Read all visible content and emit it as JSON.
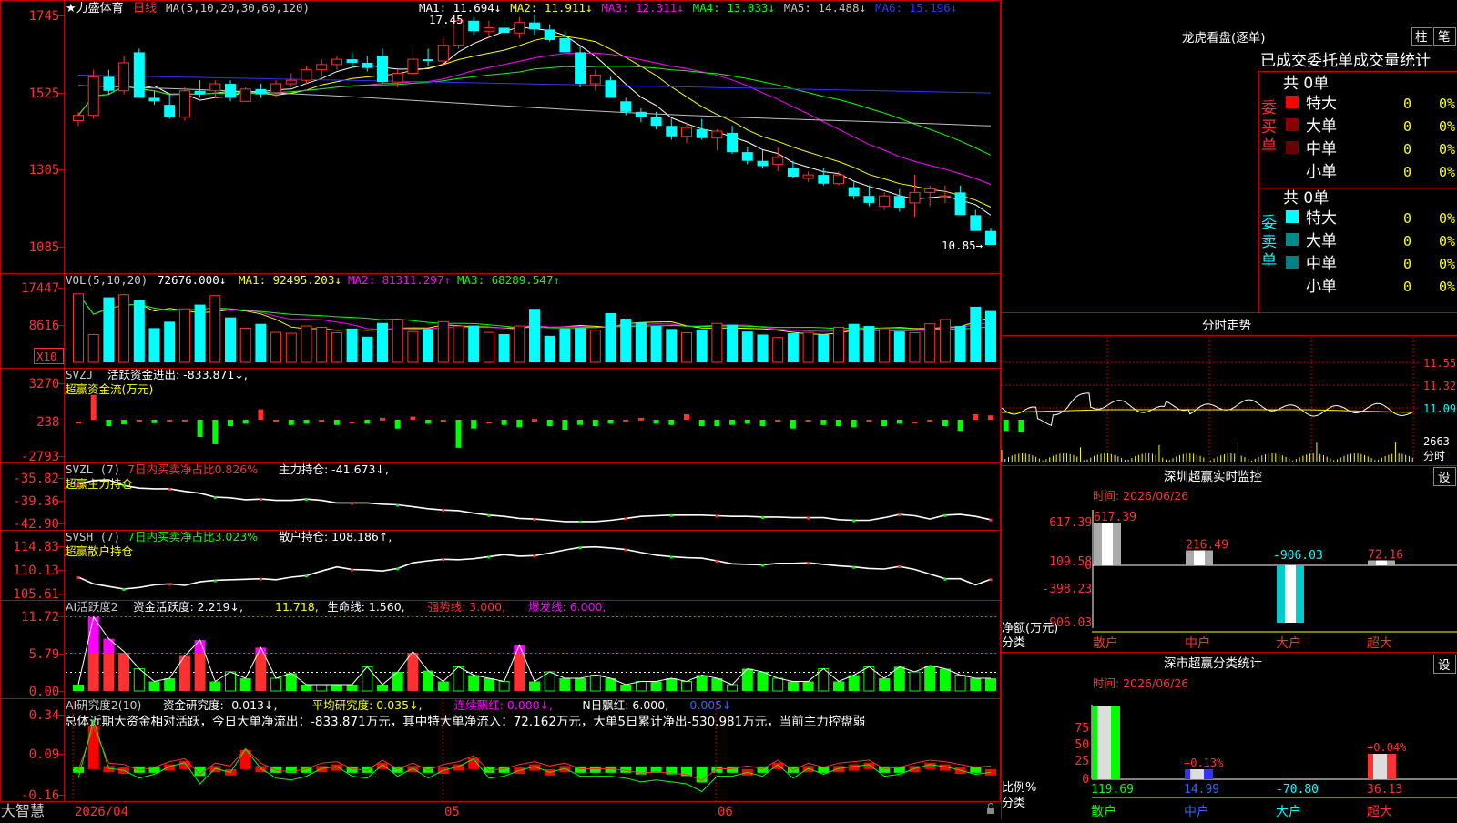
{
  "app": {
    "brand": "大智慧"
  },
  "kline": {
    "title": "★力盛体育",
    "period": "日线",
    "ma_header": "MA(5,10,20,30,60,120)",
    "ma_items": [
      {
        "text": "MA1: 11.694↓",
        "color": "#ffffff"
      },
      {
        "text": "MA2: 11.911↓",
        "color": "#ffff00"
      },
      {
        "text": "MA3: 12.311↓",
        "color": "#ff00ff"
      },
      {
        "text": "MA4: 13.033↓",
        "color": "#00ff00"
      },
      {
        "text": "MA5: 14.488↓",
        "color": "#c0c0c0"
      },
      {
        "text": "MA6: 15.196↓",
        "color": "#3333ff"
      }
    ],
    "y_ticks": [
      "1745",
      "1525",
      "1305",
      "1085"
    ],
    "high_label": "17.45",
    "low_label": "10.85→"
  },
  "vol": {
    "header": "VOL(5,10,20)",
    "value": "72676.000↓",
    "items": [
      {
        "text": "MA1: 92495.203↓",
        "color": "#ffff00"
      },
      {
        "text": "MA2: 81311.297↑",
        "color": "#ff00ff"
      },
      {
        "text": "MA3: 68289.547↑",
        "color": "#00ff00"
      }
    ],
    "y_ticks": [
      "17447",
      "8616"
    ],
    "unit": "X10"
  },
  "svzj": {
    "header": "SVZJ",
    "item": "活跃资金进出: -833.871↓,",
    "sub": "超赢资金流(万元)",
    "y_ticks": [
      "3270",
      "238",
      "-2793"
    ]
  },
  "svzl": {
    "header": "SVZL (7)",
    "item1": "7日内买卖净占比0.826%",
    "item2": "主力持仓: -41.673↓,",
    "sub": "超赢主力持仓",
    "y_ticks": [
      "-35.82",
      "-39.36",
      "-42.90"
    ]
  },
  "svsh": {
    "header": "SVSH (7)",
    "item1": "7日内买卖净占比3.023%",
    "item2": "散户持仓: 108.186↑,",
    "sub": "超赢散户持仓",
    "y_ticks": [
      "114.83",
      "110.13",
      "105.61"
    ]
  },
  "ai1": {
    "header": "AI活跃度2",
    "items": [
      {
        "text": "资金活跃度: 2.219↓,",
        "color": "#ffffff"
      },
      {
        "text": "11.718,",
        "color": "#ffff00"
      },
      {
        "text": "生命线: 1.560,",
        "color": "#ffffff"
      },
      {
        "text": "强势线: 3.000,",
        "color": "#ff3030"
      },
      {
        "text": "爆发线: 6.000,",
        "color": "#ff00ff"
      }
    ],
    "y_ticks": [
      "11.72",
      "5.79",
      "0.00"
    ]
  },
  "ai2": {
    "header": "AI研究度2(10)",
    "items": [
      {
        "text": "资金研究度: -0.013↓,",
        "color": "#ffffff"
      },
      {
        "text": "平均研究度: 0.035↓,",
        "color": "#ffff00"
      },
      {
        "text": "连续飘红: 0.000↓,",
        "color": "#ff00ff"
      },
      {
        "text": "N日飘红: 6.000,",
        "color": "#ffffff"
      },
      {
        "text": "0.005↓",
        "color": "#3366ff"
      }
    ],
    "summary": "总体近期大资金相对活跃，今日大单净流出：-833.871万元，其中特大单净流入：72.162万元，大单5日累计净出-530.981万元，当前主力控盘弱",
    "y_ticks": [
      "0.34",
      "0.09",
      "-0.16"
    ]
  },
  "xaxis": {
    "labels": [
      "2026/04",
      "05",
      "06"
    ]
  },
  "longhu": {
    "title": "龙虎看盘(逐单)",
    "btn1": "柱",
    "btn2": "笔",
    "section": "已成交委托单成交量统计",
    "buy_label": "委买单",
    "sell_label": "委卖单",
    "buy_total": "共 0单",
    "sell_total": "共 0单",
    "buy_rows": [
      {
        "name": "特大",
        "count": "0",
        "pct": "0%",
        "color": "#ff0000"
      },
      {
        "name": "大单",
        "count": "0",
        "pct": "0%",
        "color": "#8b0000"
      },
      {
        "name": "中单",
        "count": "0",
        "pct": "0%",
        "color": "#6b0000"
      },
      {
        "name": "小单",
        "count": "0",
        "pct": "0%",
        "color": ""
      }
    ],
    "sell_rows": [
      {
        "name": "特大",
        "count": "0",
        "pct": "0%",
        "color": "#00ffff"
      },
      {
        "name": "大单",
        "count": "0",
        "pct": "0%",
        "color": "#008b8b"
      },
      {
        "name": "中单",
        "count": "0",
        "pct": "0%",
        "color": "#008080"
      },
      {
        "name": "小单",
        "count": "0",
        "pct": "0%",
        "color": ""
      }
    ]
  },
  "fenshi": {
    "title": "分时走势",
    "y_ticks": [
      "11.55",
      "11.32",
      "11.09"
    ],
    "vol_tick": "2663",
    "unit": "分时"
  },
  "monitor": {
    "title": "深圳超赢实时监控",
    "btn": "设",
    "time": "时间: 2026/06/26",
    "y_ticks": [
      "617.39",
      "109.58",
      "0",
      "-398.23",
      "-906.03"
    ],
    "bar_labels": [
      "617.39",
      "216.49",
      "-906.03",
      "72.16"
    ],
    "net_label": "净额(万元)",
    "cat_label": "分类",
    "categories": [
      "散户",
      "中户",
      "大户",
      "超大"
    ]
  },
  "classify": {
    "title": "深市超赢分类统计",
    "btn": "设",
    "time": "时间: 2026/06/26",
    "y_ticks": [
      "75",
      "50",
      "25",
      "0"
    ],
    "ratio_label": "比例%",
    "cat_label": "分类",
    "values": [
      "119.69",
      "14.99",
      "-70.80",
      "36.13"
    ],
    "pct_labels": [
      "+0.13%",
      "+0.04%"
    ],
    "categories": [
      "散户",
      "中户",
      "大户",
      "超大"
    ]
  },
  "chart_data": [
    {
      "type": "candlestick",
      "title": "力盛体育 日线",
      "ylim": [
        10.85,
        17.45
      ],
      "ohlc": [
        [
          14.45,
          14.7,
          14.3,
          14.6
        ],
        [
          14.6,
          15.9,
          14.5,
          15.7
        ],
        [
          15.7,
          15.9,
          15.2,
          15.3
        ],
        [
          15.3,
          16.3,
          15.2,
          16.1
        ],
        [
          16.4,
          16.5,
          15.1,
          15.1
        ],
        [
          15.1,
          15.3,
          14.9,
          15.0
        ],
        [
          14.9,
          15.2,
          14.5,
          14.55
        ],
        [
          14.55,
          15.4,
          14.45,
          15.3
        ],
        [
          15.3,
          15.6,
          15.1,
          15.2
        ],
        [
          15.3,
          15.6,
          15.1,
          15.5
        ],
        [
          15.5,
          15.6,
          15.0,
          15.1
        ],
        [
          15.0,
          15.4,
          15.0,
          15.35
        ],
        [
          15.35,
          15.5,
          15.1,
          15.2
        ],
        [
          15.25,
          15.6,
          15.1,
          15.5
        ],
        [
          15.5,
          15.8,
          15.4,
          15.6
        ],
        [
          15.6,
          16.0,
          15.5,
          15.9
        ],
        [
          15.9,
          16.2,
          15.7,
          16.05
        ],
        [
          16.05,
          16.3,
          15.9,
          16.2
        ],
        [
          16.2,
          16.4,
          15.95,
          16.1
        ],
        [
          16.1,
          16.3,
          15.85,
          15.95
        ],
        [
          16.3,
          16.5,
          15.5,
          15.55
        ],
        [
          15.55,
          15.9,
          15.4,
          15.8
        ],
        [
          15.8,
          16.5,
          15.7,
          16.2
        ],
        [
          16.2,
          16.5,
          16.0,
          16.15
        ],
        [
          16.15,
          16.8,
          16.0,
          16.6
        ],
        [
          16.6,
          17.45,
          16.5,
          17.3
        ],
        [
          17.3,
          17.4,
          16.9,
          17.0
        ],
        [
          17.0,
          17.3,
          16.8,
          17.1
        ],
        [
          17.1,
          17.4,
          16.9,
          16.95
        ],
        [
          16.95,
          17.4,
          16.8,
          17.25
        ],
        [
          17.25,
          17.45,
          16.9,
          17.05
        ],
        [
          17.05,
          17.2,
          16.7,
          16.75
        ],
        [
          16.8,
          17.0,
          16.4,
          16.4
        ],
        [
          16.4,
          16.6,
          15.4,
          15.5
        ],
        [
          15.5,
          15.9,
          15.3,
          15.75
        ],
        [
          15.6,
          15.7,
          15.1,
          15.1
        ],
        [
          15.0,
          15.1,
          14.6,
          14.7
        ],
        [
          14.7,
          14.8,
          14.4,
          14.55
        ],
        [
          14.55,
          14.7,
          14.2,
          14.3
        ],
        [
          14.3,
          14.5,
          13.9,
          14.0
        ],
        [
          14.0,
          14.4,
          13.8,
          14.25
        ],
        [
          14.2,
          14.5,
          13.9,
          13.95
        ],
        [
          13.95,
          14.2,
          13.6,
          14.15
        ],
        [
          14.1,
          14.3,
          13.5,
          13.55
        ],
        [
          13.55,
          13.7,
          13.2,
          13.3
        ],
        [
          13.3,
          13.6,
          13.1,
          13.15
        ],
        [
          13.2,
          13.7,
          13.0,
          13.4
        ],
        [
          13.1,
          13.3,
          12.8,
          12.85
        ],
        [
          12.8,
          13.0,
          12.7,
          12.9
        ],
        [
          12.9,
          13.1,
          12.6,
          12.65
        ],
        [
          12.65,
          13.0,
          12.6,
          12.9
        ],
        [
          12.55,
          12.7,
          12.2,
          12.3
        ],
        [
          12.3,
          12.6,
          12.0,
          12.1
        ],
        [
          12.0,
          12.4,
          11.9,
          12.3
        ],
        [
          12.3,
          12.5,
          11.85,
          11.95
        ],
        [
          12.1,
          12.9,
          11.7,
          12.4
        ],
        [
          12.4,
          12.6,
          12.0,
          12.5
        ],
        [
          12.3,
          12.6,
          12.1,
          12.3
        ],
        [
          12.4,
          12.6,
          11.8,
          11.75
        ],
        [
          11.75,
          11.9,
          11.4,
          11.3
        ],
        [
          11.3,
          11.4,
          10.9,
          10.9
        ]
      ]
    },
    {
      "type": "bar",
      "title": "VOL(5,10,20)",
      "ylim": [
        0,
        17447
      ],
      "values": [
        16000,
        6500,
        15200,
        15800,
        14500,
        8000,
        9500,
        12500,
        13500,
        15600,
        10500,
        8000,
        9000,
        7000,
        6800,
        8500,
        8200,
        6900,
        7900,
        6000,
        9200,
        10000,
        7200,
        7800,
        9500,
        8500,
        8600,
        7000,
        6600,
        8500,
        12500,
        6200,
        7900,
        8000,
        7500,
        11500,
        10200,
        9300,
        8500,
        7800,
        6900,
        7700,
        9100,
        8800,
        7200,
        6500,
        5800,
        6800,
        7000,
        6500,
        8200,
        9000,
        8500,
        7900,
        7200,
        6900,
        9000,
        10000,
        8500,
        13000,
        12000
      ]
    },
    {
      "type": "bar",
      "title": "超赢资金流(万元)",
      "ylim": [
        -2793,
        3270
      ],
      "values": [
        0,
        2300,
        -300,
        -150,
        100,
        -50,
        100,
        50,
        -1200,
        -1800,
        -300,
        -100,
        1100,
        100,
        -200,
        -100,
        100,
        -200,
        0,
        -100,
        400,
        -500,
        500,
        -100,
        100,
        -2100,
        -500,
        0,
        -200,
        -400,
        300,
        -300,
        -600,
        -200,
        -300,
        -100,
        100,
        400,
        -100,
        -200,
        700,
        -300,
        -300,
        -200,
        -100,
        -300,
        200,
        -500,
        100,
        -200,
        -300,
        -400,
        200,
        -300,
        -100,
        0,
        200,
        -300,
        -700,
        700,
        600,
        -700,
        -800
      ]
    },
    {
      "type": "line",
      "title": "超赢主力持仓",
      "ylim": [
        -42.9,
        -35.82
      ],
      "values": [
        -36.8,
        -36.2,
        -36.1,
        -37.0,
        -37.4,
        -37.5,
        -37.5,
        -37.9,
        -38.2,
        -38.8,
        -38.9,
        -39.2,
        -39.1,
        -39.3,
        -39.3,
        -39.1,
        -39.3,
        -39.7,
        -39.7,
        -39.7,
        -39.9,
        -40.0,
        -40.3,
        -40.6,
        -40.8,
        -40.9,
        -41.3,
        -41.6,
        -41.8,
        -42.1,
        -42.2,
        -42.4,
        -42.6,
        -42.6,
        -42.6,
        -42.4,
        -42.1,
        -41.8,
        -41.7,
        -41.6,
        -41.6,
        -41.6,
        -41.7,
        -41.8,
        -41.8,
        -41.9,
        -41.9,
        -42.0,
        -42.0,
        -42.0,
        -42.3,
        -42.4,
        -42.4,
        -42.0,
        -41.5,
        -41.7,
        -42.2,
        -41.6,
        -41.5,
        -41.8,
        -42.3
      ]
    },
    {
      "type": "line",
      "title": "超赢散户持仓",
      "ylim": [
        105.61,
        114.83
      ],
      "values": [
        108.8,
        107.5,
        107.0,
        106.5,
        106.8,
        107.3,
        107.5,
        107.2,
        107.9,
        108.2,
        108.3,
        108.4,
        108.5,
        108.3,
        108.8,
        109.1,
        110.0,
        110.8,
        110.3,
        110.2,
        110.0,
        110.5,
        111.6,
        112.0,
        112.3,
        112.2,
        112.4,
        112.8,
        113.2,
        112.9,
        113.0,
        113.5,
        114.1,
        114.6,
        114.7,
        114.5,
        114.2,
        113.6,
        113.1,
        112.8,
        112.6,
        112.5,
        112.0,
        111.4,
        111.3,
        111.2,
        111.5,
        111.5,
        111.6,
        111.3,
        111.0,
        110.8,
        110.5,
        110.4,
        110.9,
        110.3,
        109.4,
        108.5,
        108.5,
        107.3,
        108.4
      ]
    },
    {
      "type": "bar",
      "title": "AI活跃度2",
      "ylim": [
        0,
        11.72
      ],
      "values": [
        1.0,
        11.6,
        8.2,
        6.2,
        3.5,
        1.5,
        2.0,
        5.5,
        8.0,
        1.5,
        3.0,
        2.0,
        6.8,
        2.0,
        2.8,
        1.0,
        1.0,
        1.0,
        1.0,
        3.8,
        1.0,
        3.0,
        6.2,
        3.2,
        1.5,
        3.8,
        2.5,
        2.0,
        1.5,
        7.2,
        1.5,
        3.0,
        2.0,
        2.0,
        2.5,
        2.0,
        1.0,
        1.5,
        1.5,
        2.0,
        1.5,
        2.5,
        2.0,
        1.0,
        3.5,
        3.0,
        2.0,
        1.5,
        1.5,
        3.5,
        1.5,
        2.5,
        3.8,
        2.0,
        3.8,
        3.0,
        4.0,
        3.5,
        2.5,
        2.0,
        2.0
      ]
    },
    {
      "type": "bar",
      "title": "AI研究度2(10)",
      "ylim": [
        -0.16,
        0.34
      ],
      "values": [
        -0.03,
        0.27,
        0.02,
        0.01,
        -0.03,
        -0.01,
        0.03,
        0.05,
        -0.06,
        0.02,
        0.0,
        0.12,
        0.02,
        -0.03,
        -0.04,
        -0.02,
        0.02,
        0.03,
        -0.02,
        -0.03,
        0.04,
        -0.02,
        0.02,
        -0.03,
        0.01,
        0.03,
        0.07,
        -0.03,
        -0.02,
        0.01,
        0.03,
        0.0,
        0.02,
        -0.02,
        -0.02,
        -0.02,
        -0.03,
        -0.05,
        -0.04,
        -0.05,
        -0.06,
        -0.1,
        -0.02,
        -0.02,
        0.0,
        -0.02,
        0.04,
        -0.03,
        0.02,
        -0.01,
        0.02,
        0.03,
        0.04,
        -0.02,
        -0.01,
        0.02,
        0.04,
        0.03,
        0.01,
        -0.01,
        0.0
      ]
    },
    {
      "type": "bar",
      "title": "深圳超赢实时监控",
      "categories": [
        "散户",
        "中户",
        "大户",
        "超大"
      ],
      "values": [
        617.39,
        216.49,
        -906.03,
        72.16
      ],
      "ylim": [
        -906.03,
        617.39
      ]
    },
    {
      "type": "bar",
      "title": "深市超赢分类统计",
      "categories": [
        "散户",
        "中户",
        "大户",
        "超大"
      ],
      "values": [
        119.69,
        14.99,
        -70.8,
        36.13
      ],
      "ylim": [
        0,
        75
      ]
    }
  ]
}
